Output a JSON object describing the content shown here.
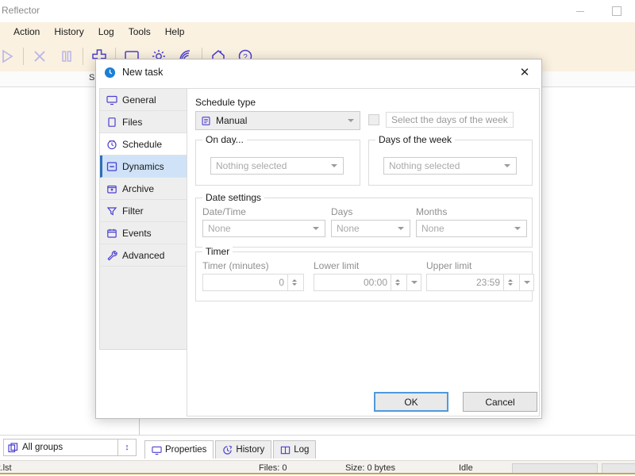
{
  "window": {
    "title": "n Reflector",
    "controls": {
      "minimize": "minimize",
      "maximize": "maximize"
    }
  },
  "menubar": {
    "items": [
      {
        "label": "Action",
        "icon": "menu-action"
      },
      {
        "label": "History",
        "icon": "menu-history"
      },
      {
        "label": "Log",
        "icon": "menu-log"
      },
      {
        "label": "Tools",
        "icon": "menu-tools"
      },
      {
        "label": "Help",
        "icon": "menu-help"
      }
    ]
  },
  "toolbar": {
    "buttons": [
      {
        "name": "start-button",
        "icon": "play-icon",
        "enabled": false
      },
      {
        "name": "stop-button",
        "icon": "close-x-icon",
        "enabled": false
      },
      {
        "name": "pause-button",
        "icon": "pause-icon",
        "enabled": false
      },
      {
        "name": "add-task-button",
        "icon": "plus-icon",
        "enabled": true
      },
      {
        "name": "monitor-button",
        "icon": "monitor-icon",
        "enabled": true
      },
      {
        "name": "settings-button",
        "icon": "gear-icon",
        "enabled": true
      },
      {
        "name": "network-button",
        "icon": "wifi-icon",
        "enabled": true
      },
      {
        "name": "home-button",
        "icon": "home-icon",
        "enabled": true
      },
      {
        "name": "help-button",
        "icon": "question-circle-icon",
        "enabled": true
      }
    ]
  },
  "main": {
    "left_pane_header": "",
    "right_pane_header_fragment": "S"
  },
  "bottom": {
    "groups_selector": {
      "label": "All groups",
      "icon": "copy-icon",
      "spinner": "↕"
    },
    "tabs": [
      {
        "label": "Properties",
        "icon": "monitor-icon",
        "active": true
      },
      {
        "label": "History",
        "icon": "history-icon",
        "active": false
      },
      {
        "label": "Log",
        "icon": "book-icon",
        "active": false
      }
    ]
  },
  "statusbar": {
    "file": "st.lst",
    "files": "Files: 0",
    "size": "Size: 0 bytes",
    "state": "Idle"
  },
  "dialog": {
    "title": "New task",
    "title_icon": "clock-icon",
    "close_icon": "✕",
    "sidebar": [
      {
        "label": "General",
        "icon": "monitor-icon",
        "state": "normal"
      },
      {
        "label": "Files",
        "icon": "file-icon",
        "state": "normal"
      },
      {
        "label": "Schedule",
        "icon": "clock-icon",
        "state": "white"
      },
      {
        "label": "Dynamics",
        "icon": "minus-box-icon",
        "state": "selected"
      },
      {
        "label": "Archive",
        "icon": "archive-icon",
        "state": "normal"
      },
      {
        "label": "Filter",
        "icon": "funnel-icon",
        "state": "normal"
      },
      {
        "label": "Events",
        "icon": "calendar-icon",
        "state": "normal"
      },
      {
        "label": "Advanced",
        "icon": "wrench-icon",
        "state": "normal"
      }
    ],
    "schedule_type": {
      "label": "Schedule type",
      "value": "Manual",
      "icon": "list-icon"
    },
    "days_checkbox": {
      "label": "Select the days of the week",
      "checked": false,
      "enabled": false
    },
    "on_day": {
      "legend": "On day...",
      "value": "Nothing selected"
    },
    "days_of_week": {
      "legend": "Days of the week",
      "value": "Nothing selected"
    },
    "date_settings": {
      "legend": "Date settings",
      "fields": [
        {
          "label": "Date/Time",
          "value": "None"
        },
        {
          "label": "Days",
          "value": "None"
        },
        {
          "label": "Months",
          "value": "None"
        }
      ]
    },
    "timer": {
      "legend": "Timer",
      "minutes": {
        "label": "Timer (minutes)",
        "value": "0"
      },
      "lower": {
        "label": "Lower limit",
        "value": "00:00"
      },
      "upper": {
        "label": "Upper limit",
        "value": "23:59"
      }
    },
    "buttons": {
      "ok": "OK",
      "cancel": "Cancel"
    }
  },
  "colors": {
    "accent": "#4b3fd0",
    "toolbar_bg": "#faf1e0",
    "selected_tab": "#cfe2f7",
    "focus_border": "#4f9ada"
  }
}
